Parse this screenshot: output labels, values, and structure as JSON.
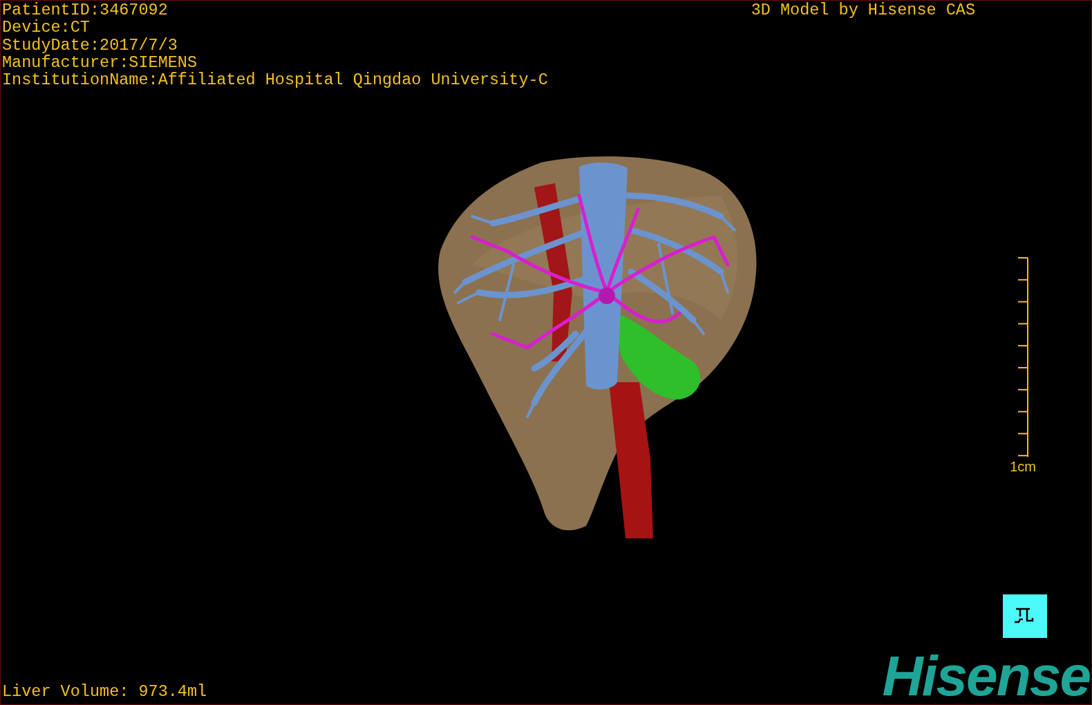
{
  "patient_info": [
    "PatientID:3467092",
    "Device:CT",
    "StudyDate:2017/7/3",
    "Manufacturer:SIEMENS",
    "InstitutionName:Affiliated Hospital Qingdao University-C"
  ],
  "title": "3D Model by Hisense CAS",
  "scale_bar": {
    "label": "1cm"
  },
  "liver_volume": "Liver Volume: 973.4ml",
  "logo": "Hisense"
}
